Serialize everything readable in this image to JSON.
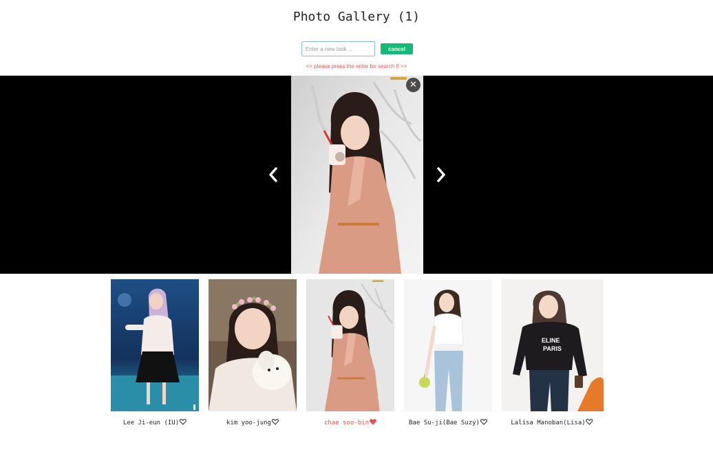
{
  "header": {
    "title": "Photo Gallery (1)"
  },
  "search": {
    "placeholder": "Enter a new task ...",
    "value": "",
    "cancel_label": "cancel",
    "hint": "<< please press the enter for search !! >>"
  },
  "viewer": {
    "current_index": 2
  },
  "thumbnails": [
    {
      "name": "Lee Ji-eun (IU)",
      "favorite": false,
      "active": false
    },
    {
      "name": "kim yoo-jung",
      "favorite": false,
      "active": false
    },
    {
      "name": "chae soo-bin",
      "favorite": true,
      "active": true
    },
    {
      "name": "Bae Su-ji(Bae Suzy)",
      "favorite": false,
      "active": false
    },
    {
      "name": "Lalisa Manoban(Lisa)",
      "favorite": false,
      "active": false
    }
  ],
  "icons": {
    "close": "close-icon",
    "prev": "chevron-left-icon",
    "next": "chevron-right-icon",
    "heart_outline": "heart-outline-icon",
    "heart_filled": "heart-filled-icon"
  },
  "colors": {
    "accent": "#17b978",
    "hint": "#e05656",
    "active_caption": "#e05656",
    "viewer_bg": "#000000"
  }
}
